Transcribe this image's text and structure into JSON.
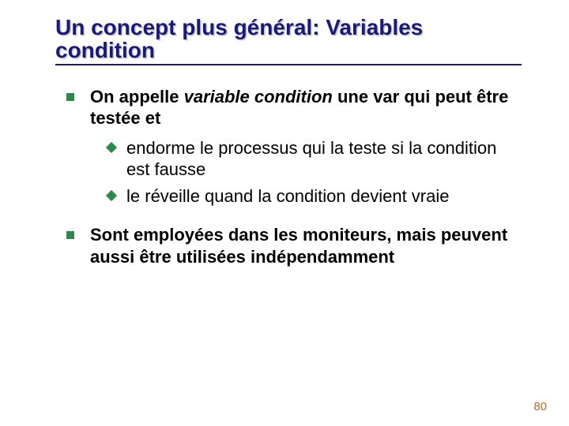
{
  "title": "Un concept plus général: Variables condition",
  "bullets": {
    "b1": {
      "pre": "On appelle ",
      "em": "variable condition",
      "post": " une var qui peut être testée et",
      "sub": {
        "s1": {
          "lead": "endorme",
          "rest": " le processus qui la teste si la condition est fausse"
        },
        "s2": {
          "lead": "le",
          "rest": " réveille quand la condition devient vraie"
        }
      }
    },
    "b2": {
      "text": "Sont employées dans les moniteurs, mais peuvent aussi être utilisées indépendamment"
    }
  },
  "pageNumber": "80"
}
